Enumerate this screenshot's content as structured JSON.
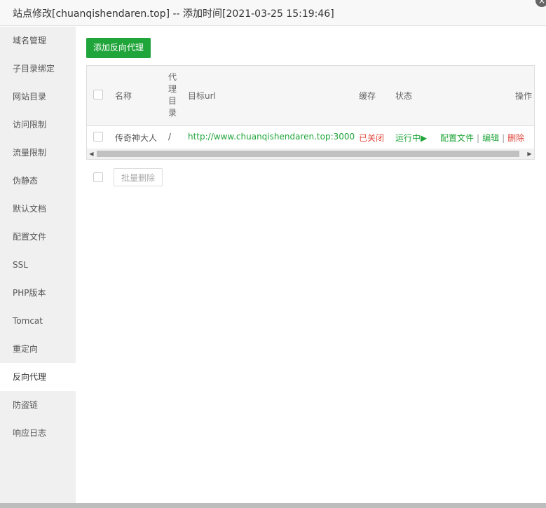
{
  "window": {
    "title": "站点修改[chuanqishendaren.top] -- 添加时间[2021-03-25 15:19:46]",
    "close_icon": "×"
  },
  "sidebar": {
    "items": [
      {
        "label": "域名管理"
      },
      {
        "label": "子目录绑定"
      },
      {
        "label": "网站目录"
      },
      {
        "label": "访问限制"
      },
      {
        "label": "流量限制"
      },
      {
        "label": "伪静态"
      },
      {
        "label": "默认文档"
      },
      {
        "label": "配置文件"
      },
      {
        "label": "SSL"
      },
      {
        "label": "PHP版本"
      },
      {
        "label": "Tomcat"
      },
      {
        "label": "重定向"
      },
      {
        "label": "反向代理",
        "active": true
      },
      {
        "label": "防盗链"
      },
      {
        "label": "响应日志"
      }
    ]
  },
  "main": {
    "add_button": "添加反向代理",
    "table": {
      "headers": {
        "name": "名称",
        "proxy_dir_lines": [
          "代",
          "理",
          "目",
          "录"
        ],
        "target_url": "目标url",
        "cache": "缓存",
        "status": "状态",
        "actions": "操作"
      },
      "rows": [
        {
          "name": "传奇神大人",
          "proxy_dir": "/",
          "target_url": "http://www.chuanqishendaren.top:3000",
          "cache": "已关闭",
          "status": "运行中▶",
          "action_config": "配置文件",
          "action_edit": "编辑",
          "action_delete": "删除",
          "separator": "|"
        }
      ]
    },
    "batch_delete": "批量删除"
  },
  "colors": {
    "accent_green": "#20a53a",
    "status_red": "#e0463b",
    "sidebar_bg": "#f0f0f0"
  }
}
